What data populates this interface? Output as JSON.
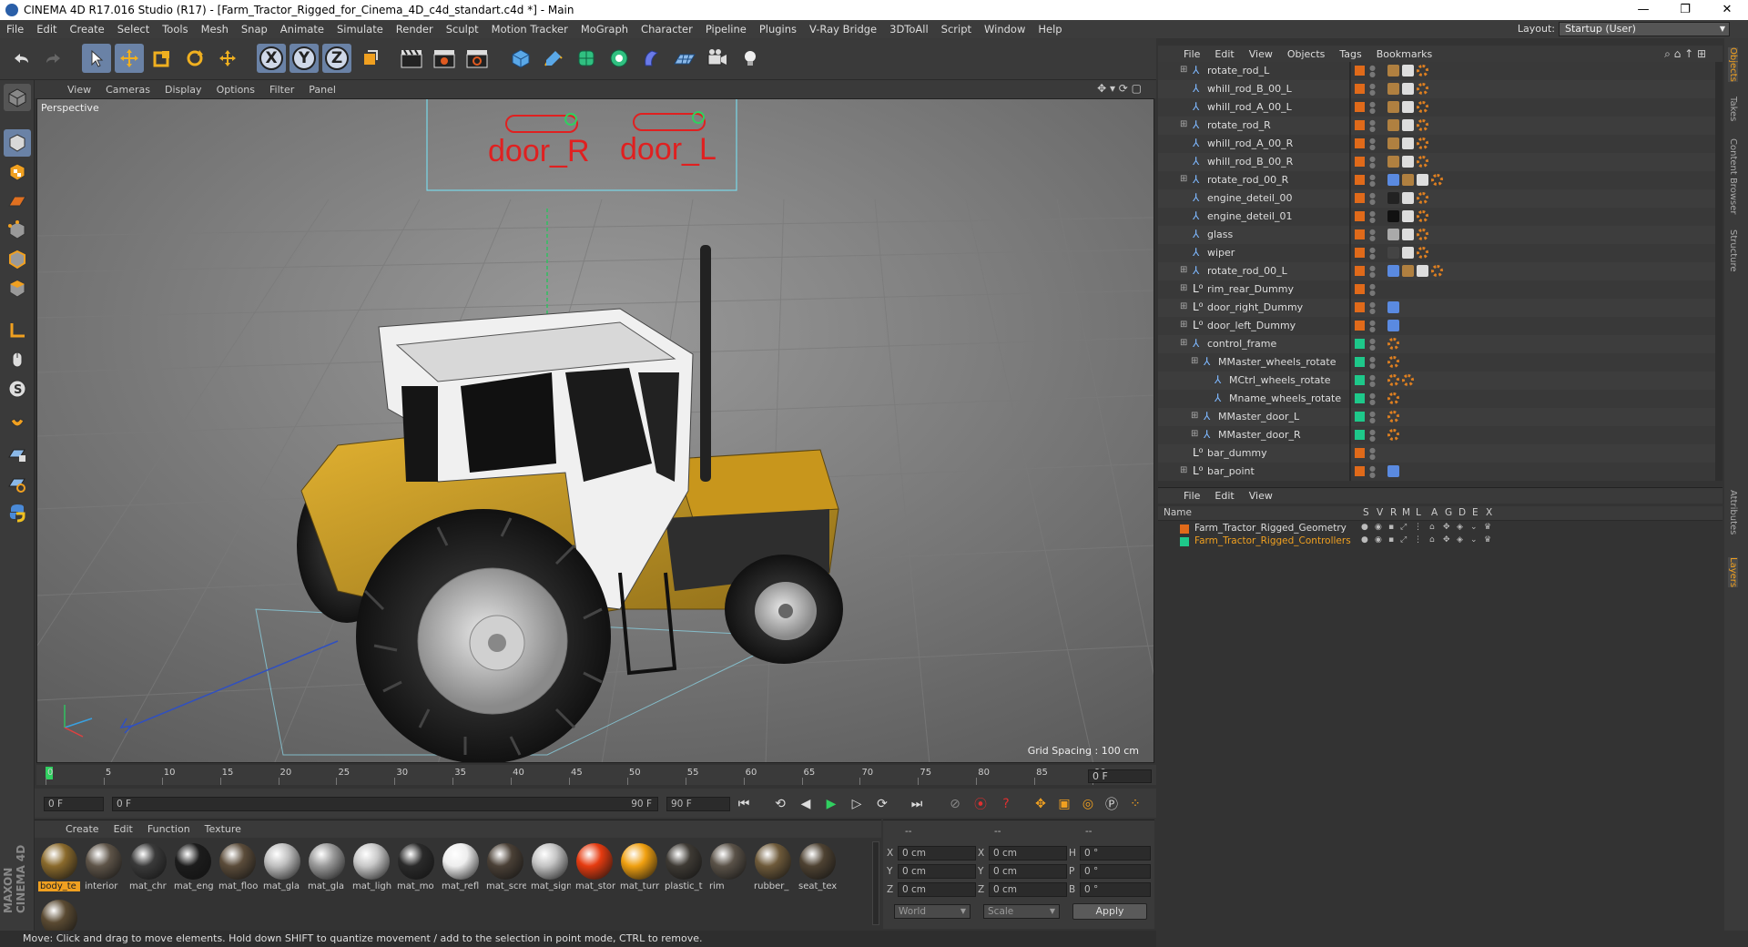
{
  "window": {
    "title": "CINEMA 4D R17.016 Studio (R17) - [Farm_Tractor_Rigged_for_Cinema_4D_c4d_standart.c4d *] - Main",
    "controls": [
      "—",
      "❐",
      "✕"
    ]
  },
  "menubar": [
    "File",
    "Edit",
    "Create",
    "Select",
    "Tools",
    "Mesh",
    "Snap",
    "Animate",
    "Simulate",
    "Render",
    "Sculpt",
    "Motion Tracker",
    "MoGraph",
    "Character",
    "Pipeline",
    "Plugins",
    "V-Ray Bridge",
    "3DToAll",
    "Script",
    "Window",
    "Help"
  ],
  "layout": {
    "label": "Layout:",
    "value": "Startup (User)"
  },
  "toolbar": {
    "axis_labels": [
      "X",
      "Y",
      "Z"
    ]
  },
  "viewport": {
    "menu": [
      "View",
      "Cameras",
      "Display",
      "Options",
      "Filter",
      "Panel"
    ],
    "label": "Perspective",
    "grid_spacing": "Grid Spacing : 100 cm",
    "overlay_labels": [
      "door_R",
      "door_L"
    ]
  },
  "timeline": {
    "ticks": [
      "0",
      "5",
      "10",
      "15",
      "20",
      "25",
      "30",
      "35",
      "40",
      "45",
      "50",
      "55",
      "60",
      "65",
      "70",
      "75",
      "80",
      "85",
      "90"
    ],
    "current_frame": "0 F",
    "start_field": "0 F",
    "range_start": "0 F",
    "range_end": "90 F",
    "end_field": "90 F"
  },
  "material_manager": {
    "menu": [
      "Create",
      "Edit",
      "Function",
      "Texture"
    ],
    "materials": [
      {
        "label": "body_te",
        "color": "#8a6a2c"
      },
      {
        "label": "interior",
        "color": "#5e5448"
      },
      {
        "label": "mat_chr",
        "color": "#3a3a3a"
      },
      {
        "label": "mat_eng",
        "color": "#1c1c1c"
      },
      {
        "label": "mat_floo",
        "color": "#5b4c3a"
      },
      {
        "label": "mat_gla",
        "color": "#bfbfbf"
      },
      {
        "label": "mat_gla",
        "color": "#9a9a9a"
      },
      {
        "label": "mat_ligh",
        "color": "#c8c8c8"
      },
      {
        "label": "mat_mo",
        "color": "#2a2a2a"
      },
      {
        "label": "mat_refl",
        "color": "#eeeeee"
      },
      {
        "label": "mat_scre",
        "color": "#4a4036"
      },
      {
        "label": "mat_sign",
        "color": "#c4c4c4"
      },
      {
        "label": "mat_stor",
        "color": "#e63b10"
      },
      {
        "label": "mat_turr",
        "color": "#f0a010"
      },
      {
        "label": "plastic_t",
        "color": "#3e3a34"
      },
      {
        "label": "rim",
        "color": "#5a5248"
      },
      {
        "label": "rubber_",
        "color": "#6e5a3a"
      },
      {
        "label": "seat_tex",
        "color": "#4e4232"
      },
      {
        "label": "",
        "color": "#5a4a32"
      }
    ]
  },
  "coordinates": {
    "headers": [
      "--",
      "--",
      "--"
    ],
    "rows": [
      {
        "a": "X",
        "av": "0 cm",
        "b": "X",
        "bv": "0 cm",
        "c": "H",
        "cv": "0 °"
      },
      {
        "a": "Y",
        "av": "0 cm",
        "b": "Y",
        "bv": "0 cm",
        "c": "P",
        "cv": "0 °"
      },
      {
        "a": "Z",
        "av": "0 cm",
        "b": "Z",
        "bv": "0 cm",
        "c": "B",
        "cv": "0 °"
      }
    ],
    "mode1": "World",
    "mode2": "Scale",
    "apply": "Apply"
  },
  "status": "Move: Click and drag to move elements. Hold down SHIFT to quantize movement / add to the selection in point mode, CTRL to remove.",
  "object_manager": {
    "menu": [
      "File",
      "Edit",
      "View",
      "Objects",
      "Tags",
      "Bookmarks"
    ],
    "objects": [
      {
        "name": "rotate_rod_L",
        "indent": 0,
        "exp": true,
        "icon": "bone",
        "color": "#e06a1a",
        "tags": [
          "#b08040",
          "#ddd",
          "#e08020"
        ]
      },
      {
        "name": "whill_rod_B_00_L",
        "indent": 0,
        "exp": false,
        "icon": "bone",
        "color": "#e06a1a",
        "tags": [
          "#b08040",
          "#ddd",
          "#e08020"
        ]
      },
      {
        "name": "whill_rod_A_00_L",
        "indent": 0,
        "exp": false,
        "icon": "bone",
        "color": "#e06a1a",
        "tags": [
          "#b08040",
          "#ddd",
          "#e08020"
        ]
      },
      {
        "name": "rotate_rod_R",
        "indent": 0,
        "exp": true,
        "icon": "bone",
        "color": "#e06a1a",
        "tags": [
          "#b08040",
          "#ddd",
          "#e08020"
        ]
      },
      {
        "name": "whill_rod_A_00_R",
        "indent": 0,
        "exp": false,
        "icon": "bone",
        "color": "#e06a1a",
        "tags": [
          "#b08040",
          "#ddd",
          "#e08020"
        ]
      },
      {
        "name": "whill_rod_B_00_R",
        "indent": 0,
        "exp": false,
        "icon": "bone",
        "color": "#e06a1a",
        "tags": [
          "#b08040",
          "#ddd",
          "#e08020"
        ]
      },
      {
        "name": "rotate_rod_00_R",
        "indent": 0,
        "exp": true,
        "icon": "bone",
        "color": "#e06a1a",
        "tags": [
          "#5a8ae0",
          "#b08040",
          "#ddd",
          "#e08020"
        ]
      },
      {
        "name": "engine_deteil_00",
        "indent": 0,
        "exp": false,
        "icon": "bone",
        "color": "#e06a1a",
        "tags": [
          "#222",
          "#ddd",
          "#e08020"
        ]
      },
      {
        "name": "engine_deteil_01",
        "indent": 0,
        "exp": false,
        "icon": "bone",
        "color": "#e06a1a",
        "tags": [
          "#111",
          "#ddd",
          "#e08020"
        ]
      },
      {
        "name": "glass",
        "indent": 0,
        "exp": false,
        "icon": "bone",
        "color": "#e06a1a",
        "tags": [
          "#aaa",
          "#ddd",
          "#e08020"
        ]
      },
      {
        "name": "wiper",
        "indent": 0,
        "exp": false,
        "icon": "bone",
        "color": "#e06a1a",
        "tags": [
          "#444",
          "#ddd",
          "#e08020"
        ]
      },
      {
        "name": "rotate_rod_00_L",
        "indent": 0,
        "exp": true,
        "icon": "bone",
        "color": "#e06a1a",
        "tags": [
          "#5a8ae0",
          "#b08040",
          "#ddd",
          "#e08020"
        ]
      },
      {
        "name": "rim_rear_Dummy",
        "indent": 0,
        "exp": true,
        "icon": "null",
        "color": "#e06a1a",
        "tags": []
      },
      {
        "name": "door_right_Dummy",
        "indent": 0,
        "exp": true,
        "icon": "null",
        "color": "#e06a1a",
        "tags": [
          "#5a8ae0"
        ]
      },
      {
        "name": "door_left_Dummy",
        "indent": 0,
        "exp": true,
        "icon": "null",
        "color": "#e06a1a",
        "tags": [
          "#5a8ae0"
        ]
      },
      {
        "name": "control_frame",
        "indent": 0,
        "exp": true,
        "icon": "bone",
        "color": "#1ec88a",
        "tags": [
          "#e08020"
        ]
      },
      {
        "name": "MMaster_wheels_rotate",
        "indent": 1,
        "exp": true,
        "icon": "bone",
        "color": "#1ec88a",
        "tags": [
          "#e08020"
        ]
      },
      {
        "name": "MCtrl_wheels_rotate",
        "indent": 2,
        "exp": false,
        "icon": "bone",
        "color": "#1ec88a",
        "tags": [
          "#e08020",
          "#e08020"
        ]
      },
      {
        "name": "Mname_wheels_rotate",
        "indent": 2,
        "exp": false,
        "icon": "bone",
        "color": "#1ec88a",
        "tags": [
          "#e08020"
        ]
      },
      {
        "name": "MMaster_door_L",
        "indent": 1,
        "exp": true,
        "icon": "bone",
        "color": "#1ec88a",
        "tags": [
          "#e08020"
        ]
      },
      {
        "name": "MMaster_door_R",
        "indent": 1,
        "exp": true,
        "icon": "bone",
        "color": "#1ec88a",
        "tags": [
          "#e08020"
        ]
      },
      {
        "name": "bar_dummy",
        "indent": 0,
        "exp": false,
        "icon": "null",
        "color": "#e06a1a",
        "tags": []
      },
      {
        "name": "bar_point",
        "indent": 0,
        "exp": true,
        "icon": "null",
        "color": "#e06a1a",
        "tags": [
          "#5a8ae0"
        ]
      }
    ]
  },
  "layer_manager": {
    "menu": [
      "File",
      "Edit",
      "View"
    ],
    "columns": [
      "Name",
      "S",
      "V",
      "R",
      "M",
      "L",
      "A",
      "G",
      "D",
      "E",
      "X"
    ],
    "layers": [
      {
        "name": "Farm_Tractor_Rigged_Geometry",
        "color": "#e06a1a",
        "text_color": "#dddddd"
      },
      {
        "name": "Farm_Tractor_Rigged_Controllers",
        "color": "#1ec88a",
        "text_color": "#f0a020"
      }
    ]
  },
  "side_tabs": [
    "Objects",
    "Takes",
    "Content Browser",
    "Structure",
    "Attributes",
    "Layers"
  ]
}
